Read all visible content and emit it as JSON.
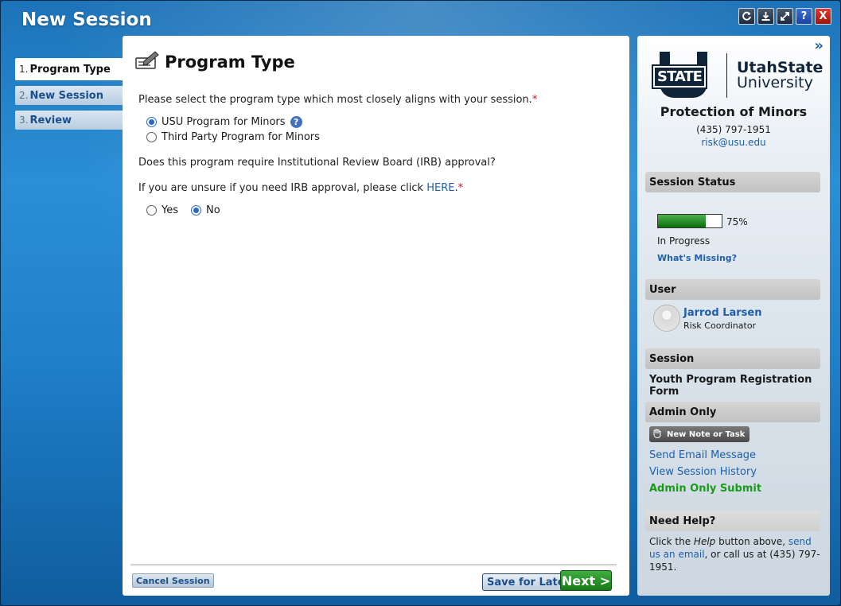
{
  "window": {
    "title": "New Session",
    "controls": [
      "refresh-icon",
      "download-icon",
      "expand-icon",
      "help-icon",
      "close-icon"
    ],
    "help_glyph": "?",
    "close_glyph": "X"
  },
  "steps": [
    {
      "num": "1.",
      "label": "Program Type",
      "active": true
    },
    {
      "num": "2.",
      "label": "New Session",
      "active": false
    },
    {
      "num": "3.",
      "label": "Review",
      "active": false
    }
  ],
  "main": {
    "title": "Program Type",
    "q1": "Please select the program type which most closely aligns with your session.",
    "required_mark": "*",
    "options": [
      {
        "label": "USU Program for Minors",
        "selected": true
      },
      {
        "label": "Third Party Program for Minors",
        "selected": false
      }
    ],
    "q2": "Does this program require Institutional Review Board (IRB) approval?",
    "q3_prefix": "If you are unsure if you need IRB approval, please click ",
    "q3_link": "HERE",
    "q3_suffix": ".",
    "yes_label": "Yes",
    "no_label": "No",
    "irb_selected": "No"
  },
  "footer": {
    "cancel": "Cancel Session",
    "save": "Save for Later",
    "next": "Next >"
  },
  "side": {
    "expand_glyph": "»",
    "logo_state": "STATE",
    "logo_l1": "UtahState",
    "logo_l2": "University",
    "org_name": "Protection of Minors",
    "phone": "(435) 797-1951",
    "email": "risk@usu.edu",
    "status_head": "Session Status",
    "progress": 0.75,
    "progress_label": "75%",
    "status_text": "In Progress",
    "whats_missing": "What's Missing?",
    "user_head": "User",
    "user_name": "Jarrod Larsen",
    "user_role": "Risk Coordinator",
    "session_head": "Session",
    "session_name": "Youth Program Registration Form",
    "admin_head": "Admin Only",
    "note_button": "New Note or Task",
    "send_email": "Send Email Message",
    "view_history": "View Session History",
    "admin_submit": "Admin Only Submit",
    "help_head": "Need Help?",
    "help_1": "Click the ",
    "help_help": "Help",
    "help_2": " button above, ",
    "help_link": "send us an email",
    "help_3": ", or call us at (435) 797-1951."
  },
  "colors": {
    "accent_blue": "#1f5faa",
    "next_green": "#167a16",
    "admin_submit_green": "#1a9a1a",
    "required_red": "#c0132a"
  }
}
